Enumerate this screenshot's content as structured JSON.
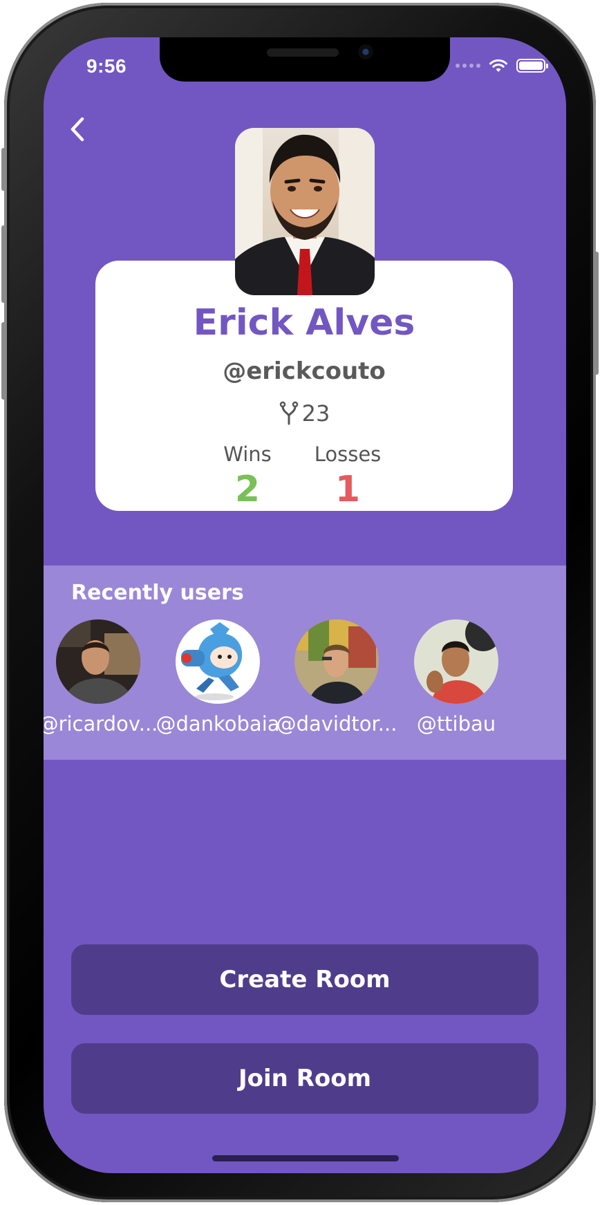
{
  "status_bar": {
    "time": "9:56"
  },
  "profile": {
    "name": "Erick Alves",
    "handle": "@erickcouto",
    "points": "23",
    "stats": {
      "wins_label": "Wins",
      "wins_value": "2",
      "losses_label": "Losses",
      "losses_value": "1"
    }
  },
  "recent": {
    "title": "Recently users",
    "users": [
      {
        "handle": "@ricardov..."
      },
      {
        "handle": "@dankobaia"
      },
      {
        "handle": "@davidtor..."
      },
      {
        "handle": "@ttibau"
      }
    ]
  },
  "actions": {
    "create_room": "Create Room",
    "join_room": "Join Room"
  },
  "colors": {
    "background": "#7257c2",
    "recent_band": "#9a87d7",
    "button": "#4f3d8c",
    "wins": "#78c156",
    "losses": "#e45a5f"
  },
  "icons": {
    "back": "chevron-left-icon",
    "points": "slingshot-icon",
    "wifi": "wifi-icon",
    "battery": "battery-icon"
  },
  "battery_level": 1.0
}
